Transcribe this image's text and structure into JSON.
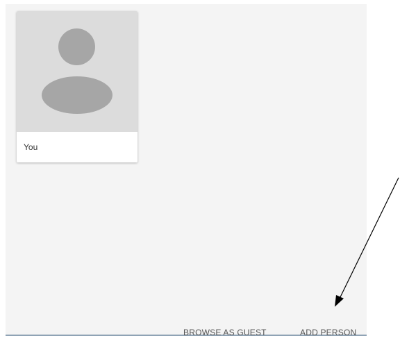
{
  "profiles": [
    {
      "name": "You",
      "avatar_icon": "person-silhouette-icon"
    }
  ],
  "footer": {
    "browse_as_guest_label": "BROWSE AS GUEST",
    "add_person_label": "ADD PERSON"
  },
  "colors": {
    "panel_background": "#f4f4f4",
    "avatar_background": "#dcdcdc",
    "avatar_silhouette": "#a6a6a6",
    "button_text": "#555555"
  }
}
